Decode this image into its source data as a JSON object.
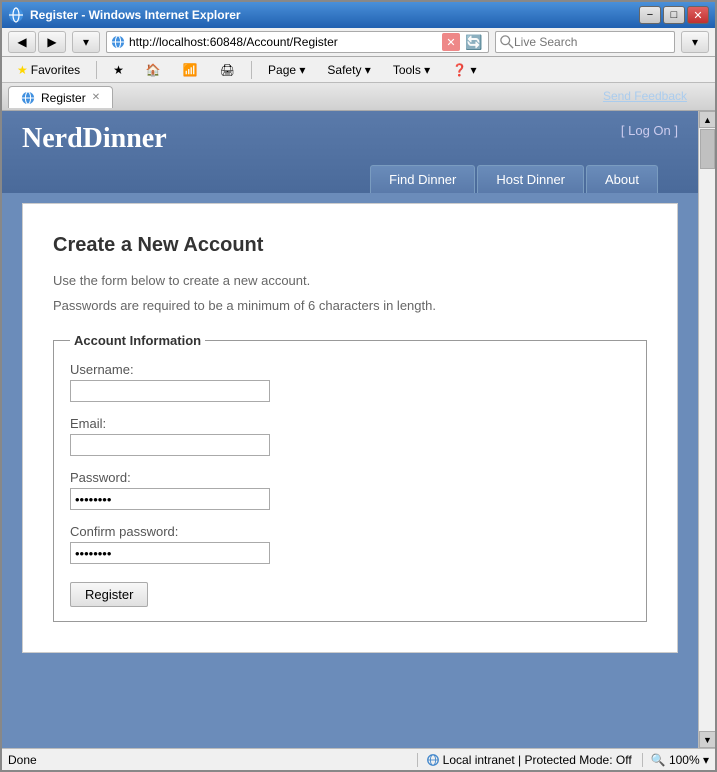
{
  "window": {
    "title": "Register - Windows Internet Explorer",
    "send_feedback": "Send Feedback"
  },
  "title_bar": {
    "text": "Register - Windows Internet Explorer",
    "min_label": "−",
    "max_label": "□",
    "close_label": "✕"
  },
  "address_bar": {
    "url": "http://localhost:60848/Account/Register",
    "go_label": "→",
    "x_label": "✕"
  },
  "live_search": {
    "placeholder": "Live Search"
  },
  "favorites_bar": {
    "favorites_label": "Favorites",
    "tab_label": "Register"
  },
  "ie_toolbar": {
    "page_label": "Page ▾",
    "safety_label": "Safety ▾",
    "tools_label": "Tools ▾",
    "help_label": "❓ ▾"
  },
  "app": {
    "title": "NerdDinner",
    "log_on_prefix": "[ ",
    "log_on_link": "Log On",
    "log_on_suffix": " ]",
    "nav": {
      "find_dinner": "Find Dinner",
      "host_dinner": "Host Dinner",
      "about": "About"
    },
    "form": {
      "page_title": "Create a New Account",
      "desc1": "Use the form below to create a new account.",
      "desc2": "Passwords are required to be a minimum of 6 characters in length.",
      "fieldset_legend": "Account Information",
      "username_label": "Username:",
      "email_label": "Email:",
      "password_label": "Password:",
      "password_value": "••••••",
      "confirm_label": "Confirm password:",
      "confirm_value": "••••••",
      "register_btn": "Register"
    }
  },
  "status_bar": {
    "status": "Done",
    "zone": "Local intranet | Protected Mode: Off",
    "zoom": "🔍 100% ▾"
  }
}
